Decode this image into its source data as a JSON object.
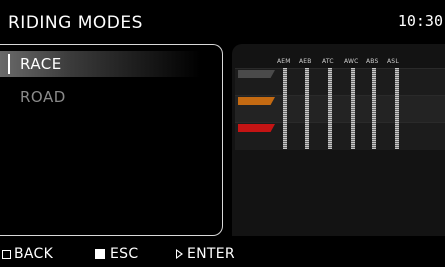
{
  "header": {
    "title": "RIDING MODES",
    "clock": "10:30"
  },
  "modes": [
    {
      "label": "RACE",
      "selected": true
    },
    {
      "label": "ROAD",
      "selected": false
    }
  ],
  "settings_grid": {
    "columns": [
      "AEM",
      "AEB",
      "ATC",
      "AWC",
      "ABS",
      "ASL"
    ],
    "rows": [
      {
        "color": "#4a4a4a"
      },
      {
        "color": "#c46a12"
      },
      {
        "color": "#c41414"
      }
    ]
  },
  "footer": {
    "back_label": "BACK",
    "esc_label": "ESC",
    "enter_label": "ENTER"
  },
  "colors": {
    "background": "#000000",
    "selected_highlight": "#5a5a5a",
    "dim_text": "#8a8a8a"
  }
}
